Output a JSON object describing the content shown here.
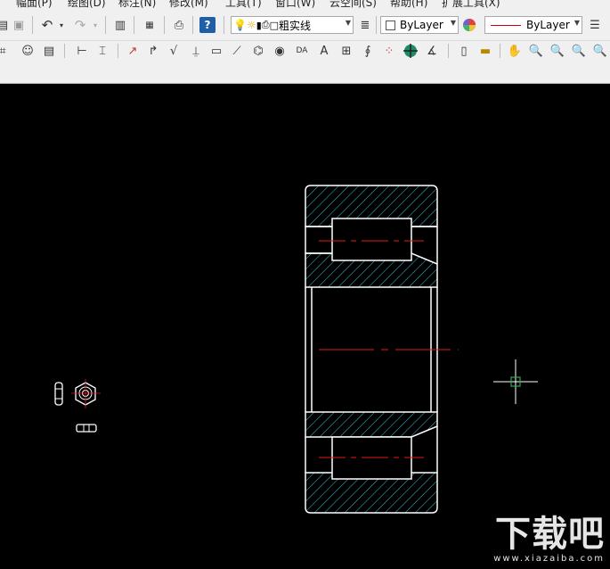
{
  "menu": [
    {
      "label": "幅面(P)"
    },
    {
      "label": "绘图(D)"
    },
    {
      "label": "标注(N)"
    },
    {
      "label": "修改(M)"
    },
    {
      "label": "工具(T)"
    },
    {
      "label": "窗口(W)"
    },
    {
      "label": "云空间(S)"
    },
    {
      "label": "帮助(H)"
    },
    {
      "label": "扩展工具(X)"
    }
  ],
  "toolbar": {
    "linetype_label": "粗实线",
    "color_label": "ByLayer",
    "linestyle_label": "ByLayer"
  },
  "colors": {
    "canvas": "#000000",
    "outline": "#ffffff",
    "hatch": "#34c5d9",
    "centerline": "#e01b1b",
    "cursor": "#2fa84f"
  },
  "watermark": {
    "brand": "下载吧",
    "site": "www.xiazaiba.com"
  }
}
